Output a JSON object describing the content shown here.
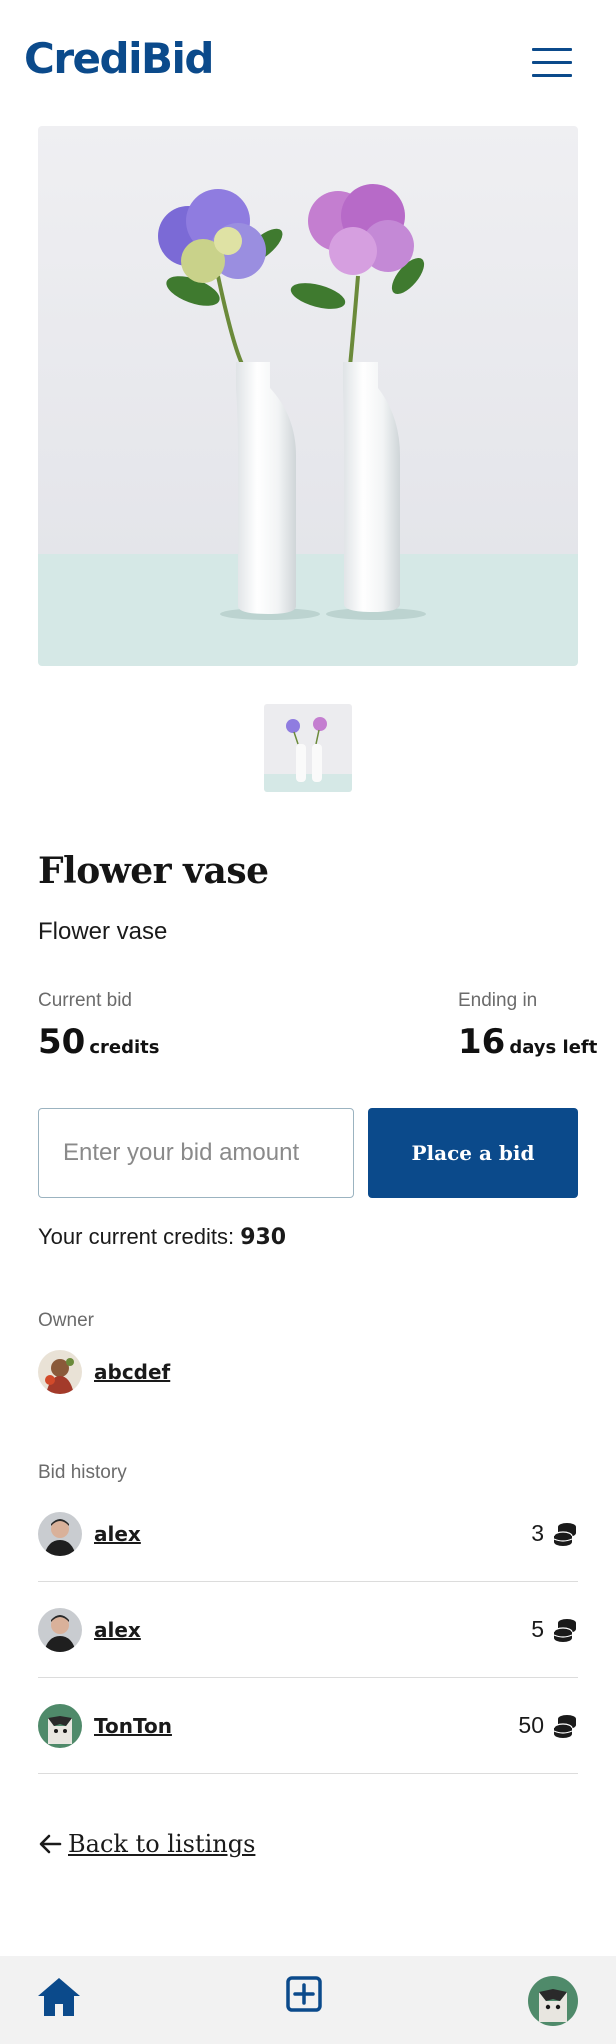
{
  "header": {
    "logo": "CrediBid",
    "menu_icon": "hamburger-menu-icon"
  },
  "listing": {
    "title": "Flower vase",
    "description": "Flower vase",
    "image_count": 1
  },
  "stats": {
    "current_bid_label": "Current bid",
    "current_bid_value": "50",
    "current_bid_unit": "credits",
    "ending_label": "Ending in",
    "ending_value": "16",
    "ending_unit": "days left"
  },
  "bid_form": {
    "placeholder": "Enter your bid amount",
    "button_label": "Place a bid"
  },
  "credits": {
    "label": "Your current credits:",
    "value": "930"
  },
  "owner": {
    "label": "Owner",
    "username": "abcdef"
  },
  "bid_history": {
    "label": "Bid history",
    "rows": [
      {
        "username": "alex",
        "amount": "3",
        "icon": "coins-icon"
      },
      {
        "username": "alex",
        "amount": "5",
        "icon": "coins-icon"
      },
      {
        "username": "TonTon",
        "amount": "50",
        "icon": "coins-icon"
      }
    ]
  },
  "back_link": {
    "label": "Back to listings",
    "icon": "arrow-left-icon"
  },
  "bottom_nav": {
    "items": [
      "home-icon",
      "add-listing-icon",
      "profile-avatar"
    ]
  },
  "colors": {
    "brand": "#0b4a8b",
    "text": "#1a1a1a",
    "muted": "#6b6b6b",
    "nav_bg": "#f2f2f2"
  }
}
